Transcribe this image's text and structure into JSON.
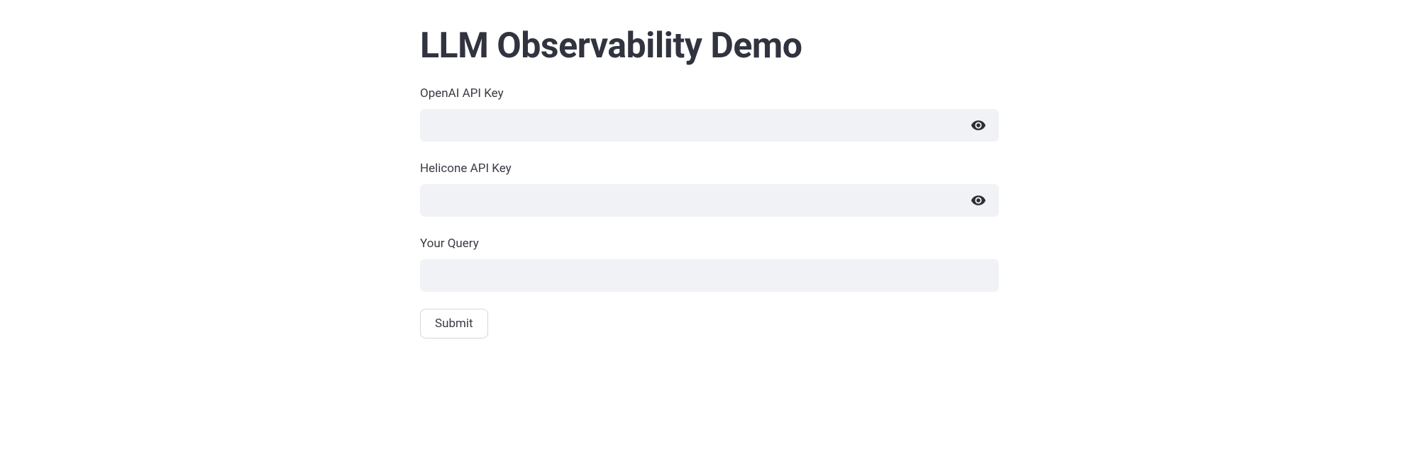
{
  "page": {
    "title": "LLM Observability Demo"
  },
  "form": {
    "fields": {
      "openai_key": {
        "label": "OpenAI API Key",
        "value": "",
        "placeholder": ""
      },
      "helicone_key": {
        "label": "Helicone API Key",
        "value": "",
        "placeholder": ""
      },
      "query": {
        "label": "Your Query",
        "value": "",
        "placeholder": ""
      }
    },
    "submit_label": "Submit"
  }
}
